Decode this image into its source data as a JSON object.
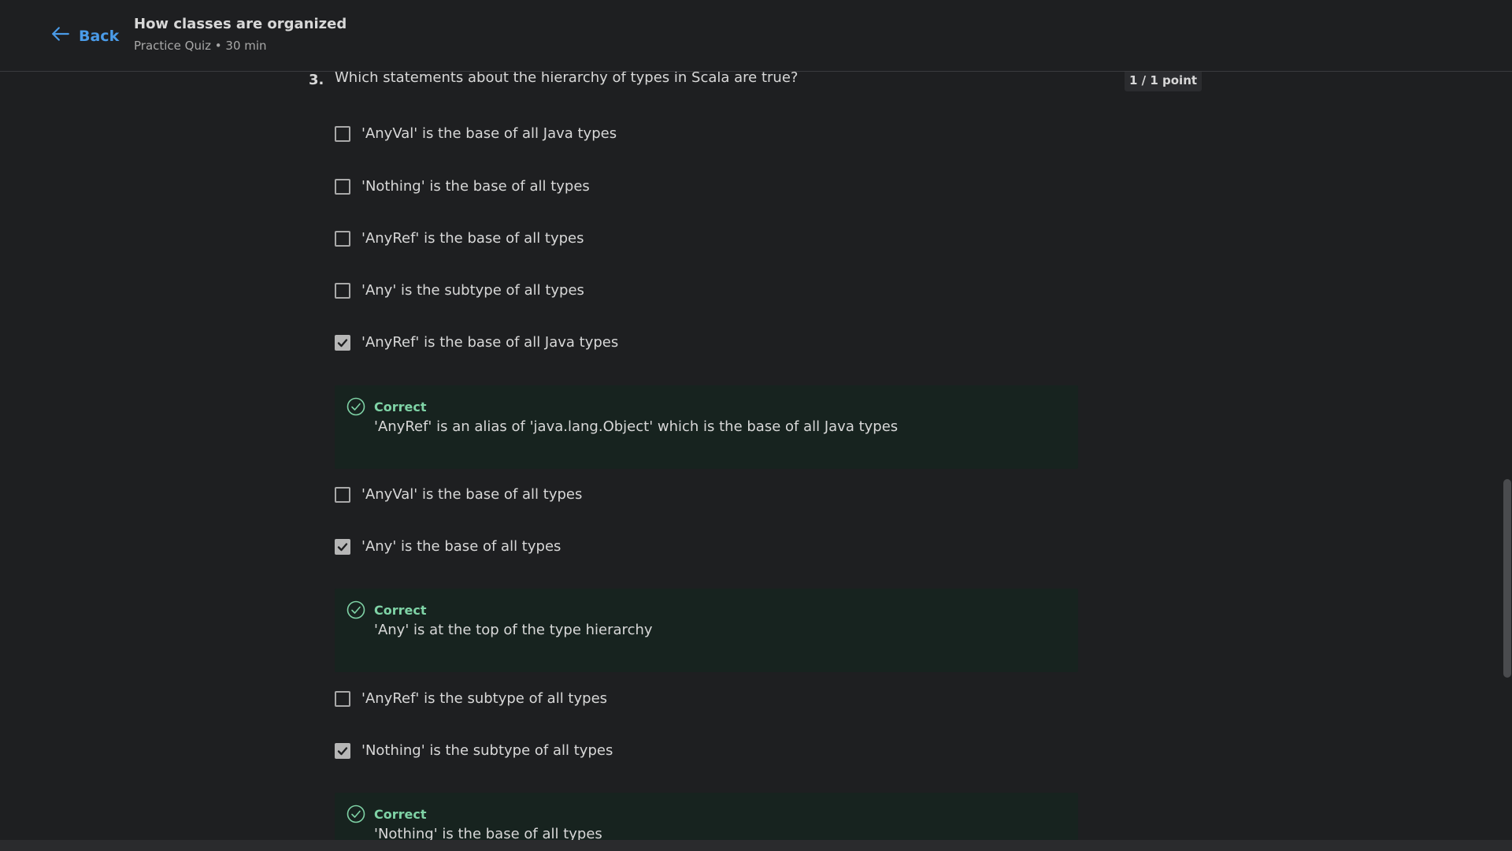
{
  "header": {
    "back_label": "Back",
    "title": "How classes are organized",
    "subtitle": "Practice Quiz • 30 min"
  },
  "question": {
    "number": "3.",
    "text": "Which statements about the hierarchy of types in Scala are true?",
    "points": "1 / 1 point"
  },
  "options": [
    {
      "label": "'AnyVal' is the base of all Java types",
      "checked": false
    },
    {
      "label": "'Nothing' is the base of all types",
      "checked": false
    },
    {
      "label": "'AnyRef' is the base of all types",
      "checked": false
    },
    {
      "label": "'Any' is the subtype of all types",
      "checked": false
    },
    {
      "label": "'AnyRef' is the base of all Java types",
      "checked": true
    },
    {
      "label": "'AnyVal' is the base of all types",
      "checked": false
    },
    {
      "label": "'Any' is the base of all types",
      "checked": true
    },
    {
      "label": "'AnyRef' is the subtype of all types",
      "checked": false
    },
    {
      "label": "'Nothing' is the subtype of all types",
      "checked": true
    }
  ],
  "feedback": [
    {
      "label": "Correct",
      "text": "'AnyRef' is an alias of 'java.lang.Object' which is the base of all Java types"
    },
    {
      "label": "Correct",
      "text": "'Any' is at the top of the type hierarchy"
    },
    {
      "label": "Correct",
      "text": "'Nothing' is the base of all types"
    }
  ],
  "colors": {
    "background": "#1e1f21",
    "accent": "#4a9be8",
    "correct": "#7fd3a6",
    "feedback_bg": "#17231f"
  },
  "icons": {
    "back": "arrow-left-icon",
    "check": "checkmark-icon",
    "correct": "check-circle-icon"
  }
}
